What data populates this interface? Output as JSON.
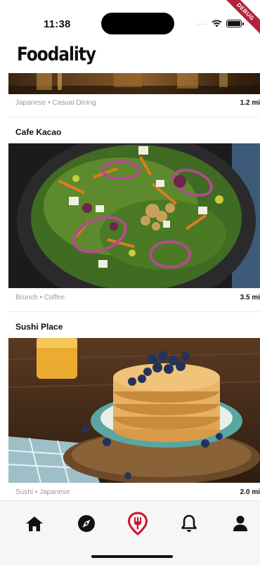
{
  "status_bar": {
    "time": "11:38",
    "signal_text": "....",
    "debug_banner": "DEBUG"
  },
  "header": {
    "logo": "Foodality"
  },
  "feed": {
    "cards": [
      {
        "name": "",
        "meta": "Japanese • Casual Dining",
        "distance": "1.2 mi",
        "image": "restaurant-interior"
      },
      {
        "name": "Cafe Kacao",
        "meta": "Brunch • Coffee",
        "distance": "3.5 mi",
        "image": "salad-bowl"
      },
      {
        "name": "Sushi Place",
        "meta": "Sushi • Japanese",
        "distance": "2.0 mi",
        "image": "pancake-stack"
      }
    ]
  },
  "bottom_nav": {
    "active_index": 2,
    "items": [
      {
        "id": "home",
        "icon": "home-icon"
      },
      {
        "id": "explore",
        "icon": "compass-icon"
      },
      {
        "id": "restaurants",
        "icon": "fork-pin-icon"
      },
      {
        "id": "notifications",
        "icon": "bell-icon"
      },
      {
        "id": "profile",
        "icon": "person-icon"
      }
    ]
  },
  "colors": {
    "accent": "#d4102b",
    "text": "#111111",
    "muted": "#9a9a9a",
    "nav_bg": "#f6f6f6"
  }
}
